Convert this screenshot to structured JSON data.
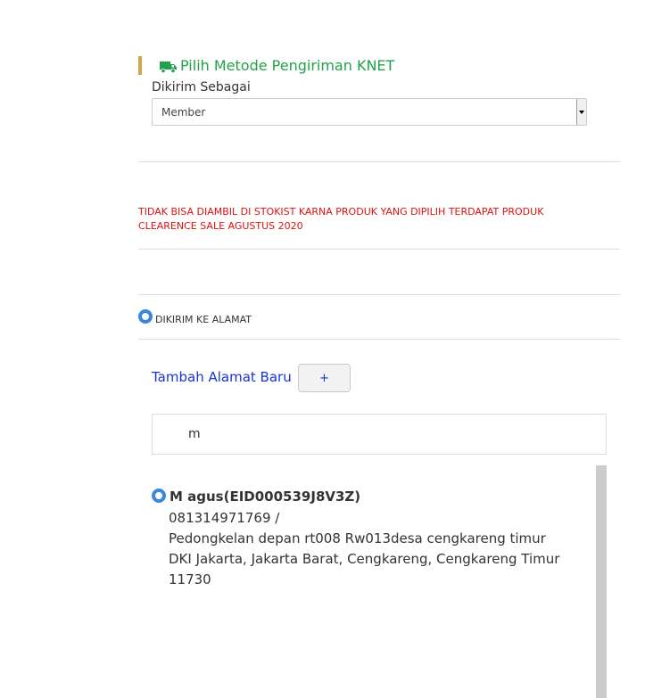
{
  "shipping_method": {
    "title": "Pilih Metode Pengiriman KNET",
    "send_as_label": "Dikirim Sebagai",
    "send_as_value": "Member",
    "accent_color": "#22a14a",
    "bar_color": "#d4a54b"
  },
  "warning_text": "TIDAK BISA DIAMBIL DI STOKIST KARNA PRODUK YANG DIPILIH TERDAPAT PRODUK CLEARENCE SALE AGUSTUS 2020",
  "delivery_option": {
    "label": "DIKIRIM KE ALAMAT",
    "selected": true
  },
  "add_address": {
    "label": "Tambah Alamat Baru",
    "button_label": "+"
  },
  "search": {
    "value": "m"
  },
  "addresses": [
    {
      "selected": true,
      "name": "M agus(EID000539J8V3Z)",
      "phone": "081314971769 /",
      "street": "Pedongkelan depan rt008 Rw013desa cengkareng timur",
      "region": "DKI Jakarta, Jakarta Barat, Cengkareng, Cengkareng Timur",
      "postal_code": "11730"
    }
  ]
}
